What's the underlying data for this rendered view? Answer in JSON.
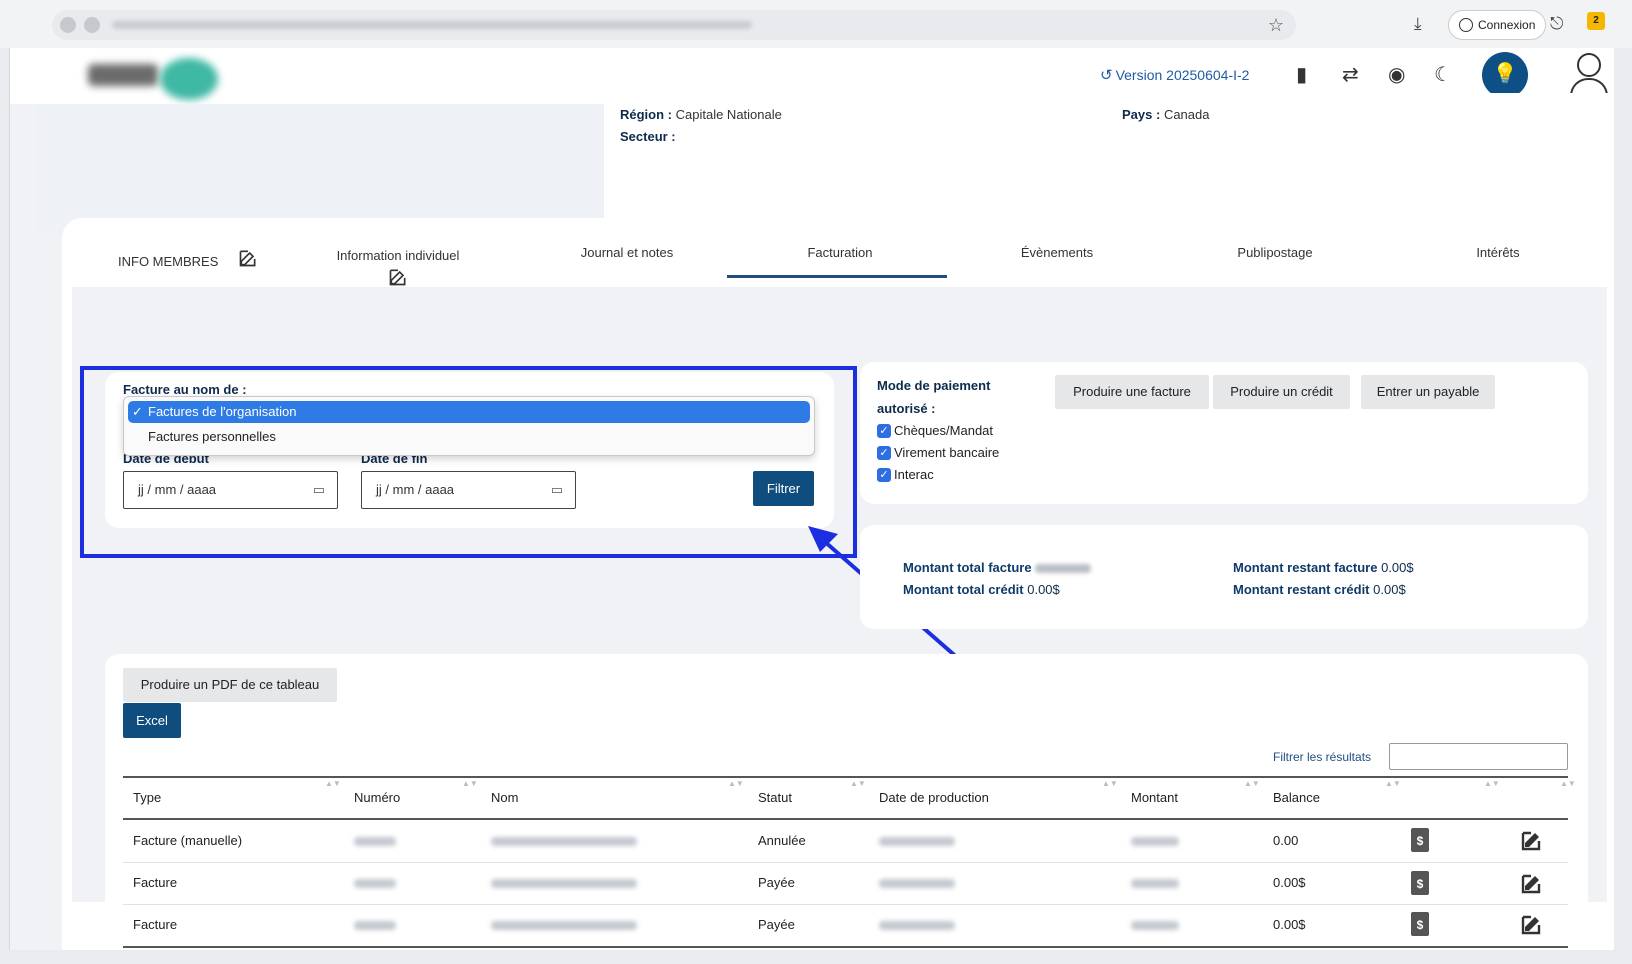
{
  "browser": {
    "connexion_label": "Connexion",
    "ext_badge": "2"
  },
  "header": {
    "version_label": "Version 20250604-I-2"
  },
  "info": {
    "region_key": "Région :",
    "region_value": "Capitale Nationale",
    "secteur_key": "Secteur :",
    "pays_key": "Pays :",
    "pays_value": "Canada"
  },
  "tabs": [
    {
      "label": "INFO MEMBRES"
    },
    {
      "label": "Information individuel"
    },
    {
      "label": "Journal et notes"
    },
    {
      "label": "Facturation"
    },
    {
      "label": "Évènements"
    },
    {
      "label": "Publipostage"
    },
    {
      "label": "Intérêts"
    }
  ],
  "filter_form": {
    "facture_label": "Facture au nom de :",
    "options": [
      "Factures de l'organisation",
      "Factures personnelles"
    ],
    "selected": "Factures de l'organisation",
    "date_debut_label": "Date de début",
    "date_fin_label": "Date de fin",
    "date_placeholder": "jj / mm / aaaa",
    "filter_button": "Filtrer"
  },
  "payment": {
    "title_line1": "Mode de paiement",
    "title_line2": "autorisé :",
    "methods": [
      "Chèques/Mandat",
      "Virement bancaire",
      "Interac"
    ],
    "buttons": [
      "Produire une facture",
      "Produire un crédit",
      "Entrer un payable"
    ]
  },
  "summary": {
    "total_facture_label": "Montant total facture",
    "total_credit_label": "Montant total crédit",
    "total_credit_value": "0.00$",
    "restant_facture_label": "Montant restant facture",
    "restant_facture_value": "0.00$",
    "restant_credit_label": "Montant restant crédit",
    "restant_credit_value": "0.00$"
  },
  "table_tools": {
    "pdf_button": "Produire un PDF de ce tableau",
    "excel_button": "Excel",
    "filter_label": "Filtrer les résultats"
  },
  "table": {
    "headers": [
      "Type",
      "Numéro",
      "Nom",
      "Statut",
      "Date de production",
      "Montant",
      "Balance"
    ],
    "rows": [
      {
        "type": "Facture (manuelle)",
        "statut": "Annulée",
        "balance": "0.00"
      },
      {
        "type": "Facture",
        "statut": "Payée",
        "balance": "0.00$"
      },
      {
        "type": "Facture",
        "statut": "Payée",
        "balance": "0.00$"
      }
    ]
  },
  "colors": {
    "accent": "#0f4d7e",
    "highlight": "#1b2fe0",
    "dropdown_selected": "#2f7be6"
  }
}
